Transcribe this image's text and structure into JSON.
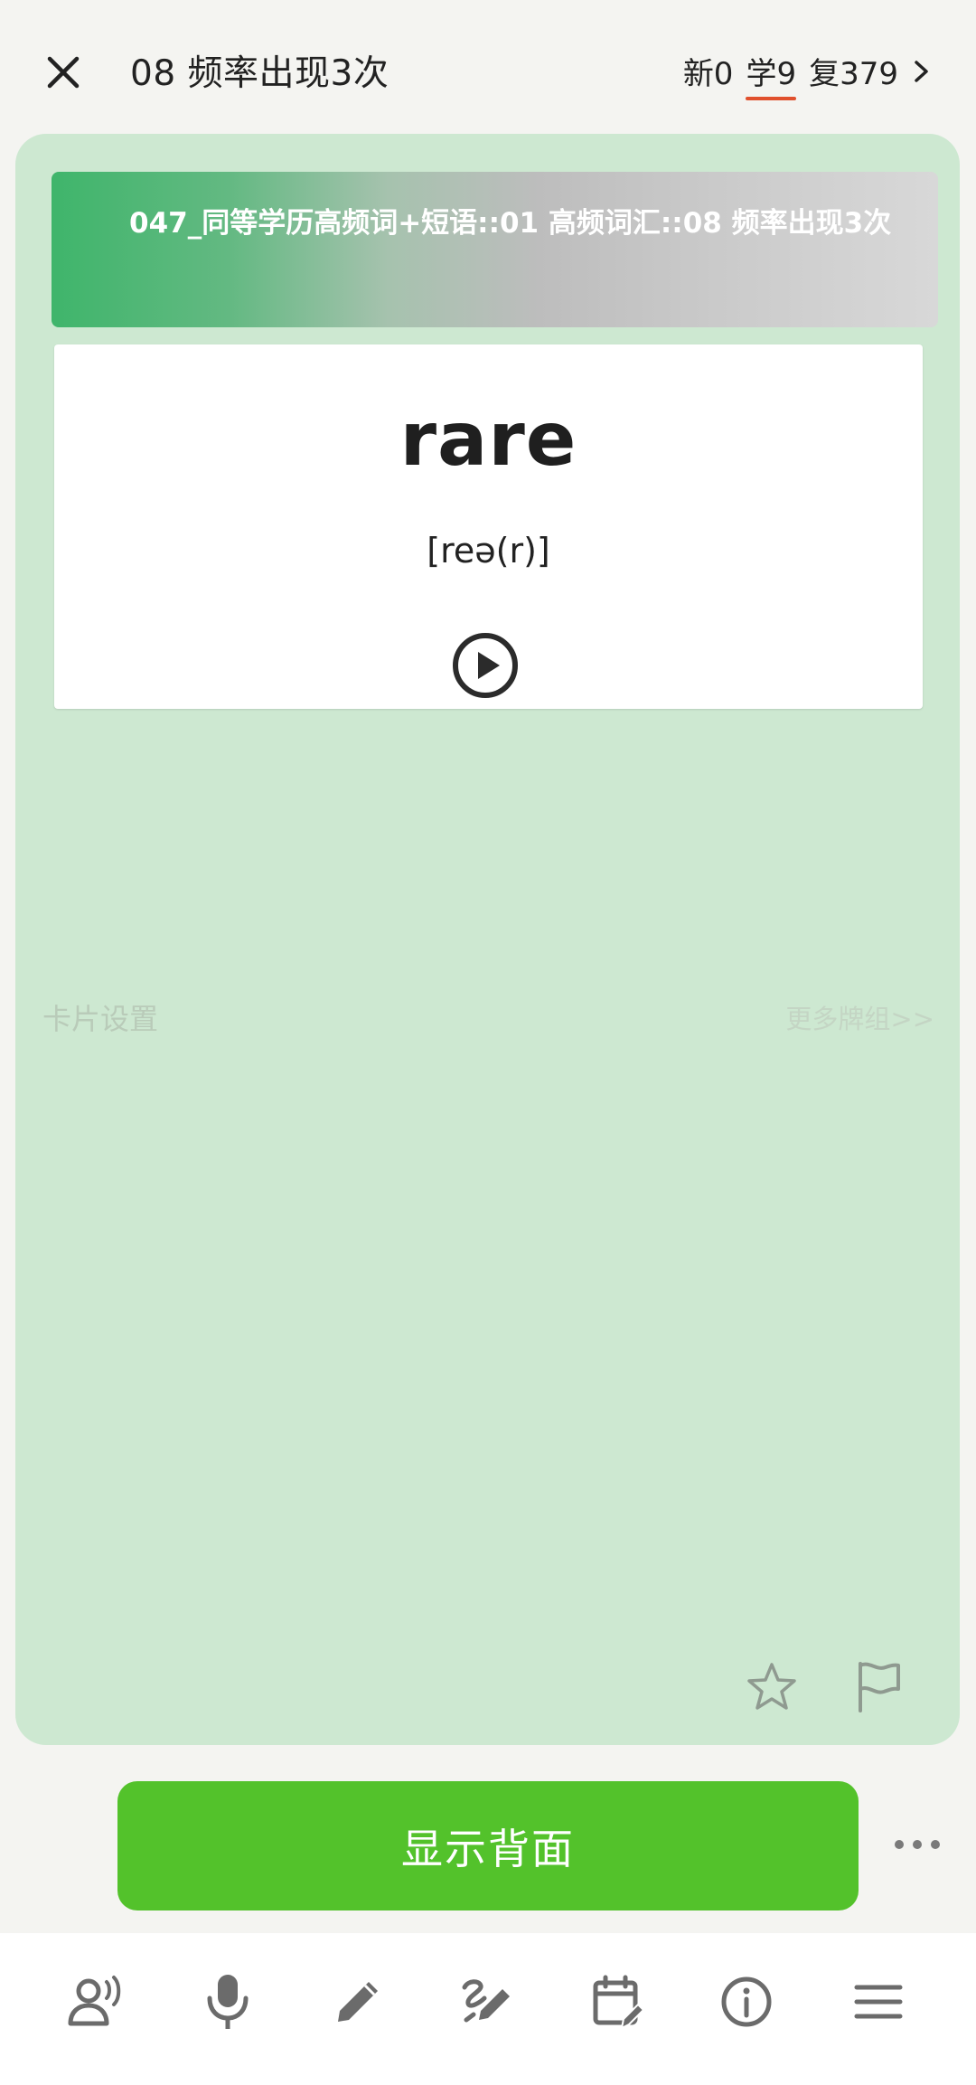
{
  "header": {
    "title": "08 频率出现3次",
    "stats": {
      "new": "新0",
      "learn": "学9",
      "review": "复379",
      "chevron": ">"
    }
  },
  "deck": {
    "path": "047_同等学历高频词+短语::01 高频词汇::08 频率出现3次"
  },
  "card": {
    "word": "rare",
    "phonetic": "[reə(r)]"
  },
  "links": {
    "card_settings": "卡片设置",
    "more_decks": "更多牌组>>"
  },
  "actions": {
    "show_back": "显示背面"
  },
  "toolbar": {
    "icons": [
      "speak-icon",
      "microphone-icon",
      "pencil-icon",
      "handwriting-icon",
      "calendar-edit-icon",
      "info-icon",
      "menu-icon"
    ]
  },
  "colors": {
    "accent_green": "#53c22b",
    "card_area_bg": "#cde8d1",
    "learn_underline": "#e0502d"
  }
}
